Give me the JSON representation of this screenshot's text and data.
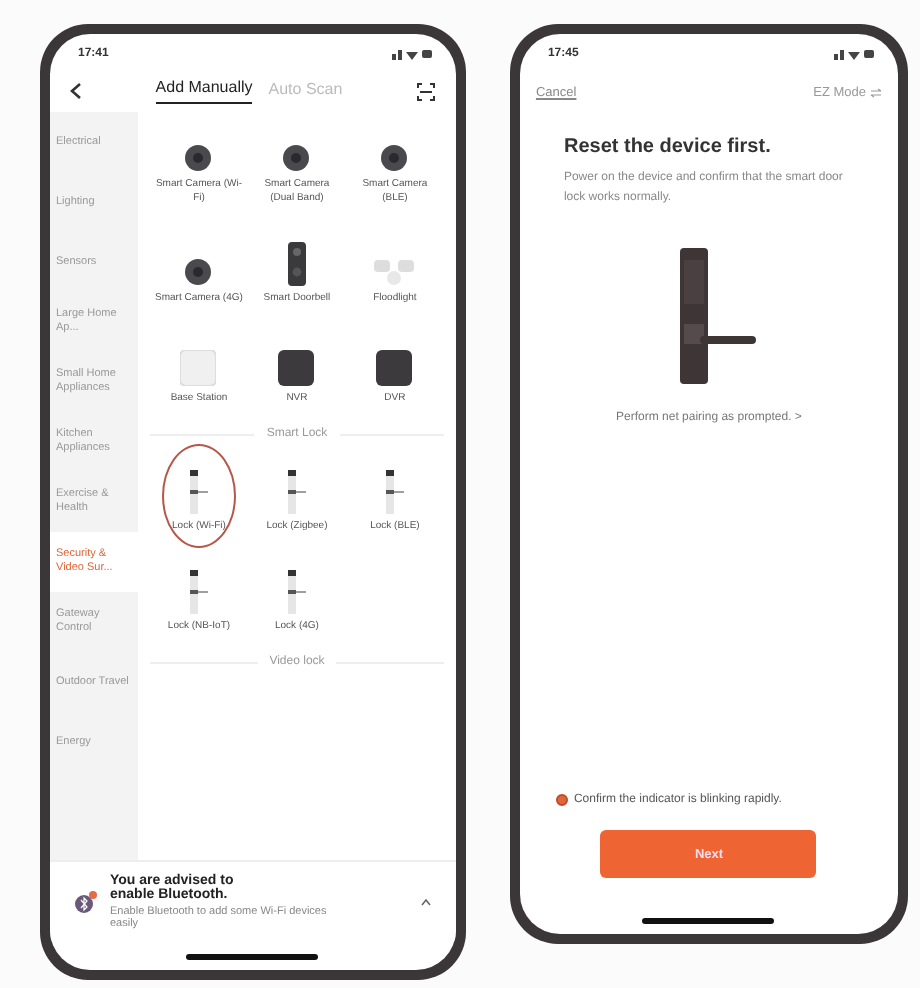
{
  "left_phone": {
    "status_time": "17:41",
    "tabs": [
      {
        "label": "Add Manually",
        "selected": true
      },
      {
        "label": "Auto Scan",
        "selected": false
      }
    ],
    "sidebar": {
      "items": [
        {
          "label": "Electrical",
          "selected": false
        },
        {
          "label": "Lighting",
          "selected": false
        },
        {
          "label": "Sensors",
          "selected": false
        },
        {
          "label": "Large Home Ap...",
          "selected": false
        },
        {
          "label": "Small Home Appliances",
          "selected": false
        },
        {
          "label": "Kitchen Appliances",
          "selected": false
        },
        {
          "label": "Exercise & Health",
          "selected": false
        },
        {
          "label": "Security & Video Sur...",
          "selected": true
        },
        {
          "label": "Gateway Control",
          "selected": false
        },
        {
          "label": "Outdoor Travel",
          "selected": false
        },
        {
          "label": "Energy",
          "selected": false
        }
      ]
    },
    "sections": [
      {
        "devices": [
          {
            "kind": "camera",
            "label": "Smart Camera (Wi-Fi)",
            "highlighted": false
          },
          {
            "kind": "camera",
            "label": "Smart Camera (Dual Band)",
            "highlighted": false
          },
          {
            "kind": "camera",
            "label": "Smart Camera (BLE)",
            "highlighted": false
          },
          {
            "kind": "camera",
            "label": "Smart Camera (4G)",
            "highlighted": false
          },
          {
            "kind": "doorbell",
            "label": "Smart Doorbell",
            "highlighted": false
          },
          {
            "kind": "floodlight",
            "label": "Floodlight",
            "highlighted": false
          },
          {
            "kind": "base-station",
            "label": "Base Station",
            "highlighted": false
          },
          {
            "kind": "recorder",
            "label": "NVR",
            "highlighted": false
          },
          {
            "kind": "recorder",
            "label": "DVR",
            "highlighted": false
          }
        ]
      },
      {
        "title": "Smart Lock",
        "devices": [
          {
            "kind": "lock",
            "label": "Lock (Wi-Fi)",
            "highlighted": true
          },
          {
            "kind": "lock",
            "label": "Lock (Zigbee)",
            "highlighted": false
          },
          {
            "kind": "lock",
            "label": "Lock (BLE)",
            "highlighted": false
          },
          {
            "kind": "lock",
            "label": "Lock (NB-IoT)",
            "highlighted": false
          },
          {
            "kind": "lock",
            "label": "Lock (4G)",
            "highlighted": false
          }
        ]
      },
      {
        "title": "Video lock"
      }
    ],
    "banner": {
      "title": "You are advised to enable Bluetooth.",
      "text": "Enable Bluetooth to add some Wi-Fi devices easily"
    }
  },
  "right_phone": {
    "status_time": "17:45",
    "cancel": "Cancel",
    "mode": "EZ Mode",
    "heading": "Reset the device first.",
    "description": "Power on the device and confirm that the smart door lock works normally.",
    "link": "Perform net pairing as prompted. >",
    "confirm": {
      "label": "Confirm the indicator is blinking rapidly.",
      "checked": true
    },
    "button": "Next"
  }
}
